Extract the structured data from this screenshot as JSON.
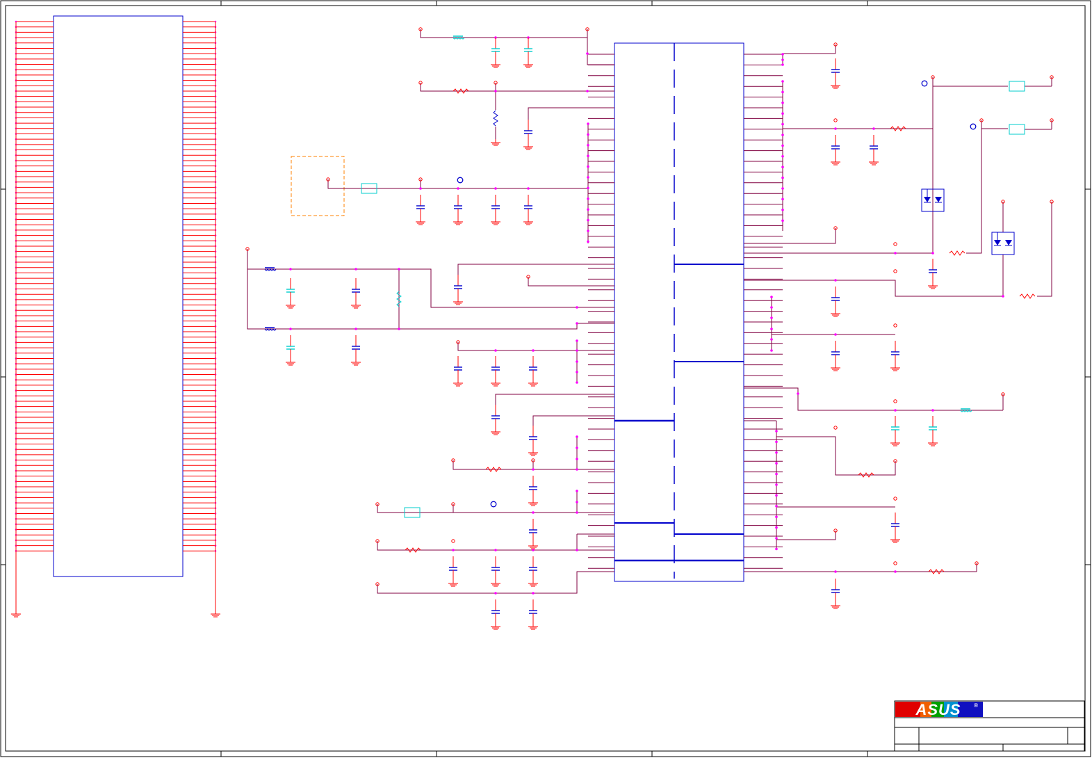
{
  "title_block": {
    "logo_text": "ASUS",
    "registered_mark": "®"
  },
  "colors": {
    "wire": "#800040",
    "pin": "#ff0000",
    "body": "#0000cc",
    "junction": "#ff00ff",
    "cap_light": "#00cccc",
    "keepout": "#ff8000",
    "frame": "#000000"
  },
  "connector": {
    "pin_rows_per_side": 100
  },
  "main_ic": {
    "left_pins": 50,
    "right_pins": 50
  }
}
